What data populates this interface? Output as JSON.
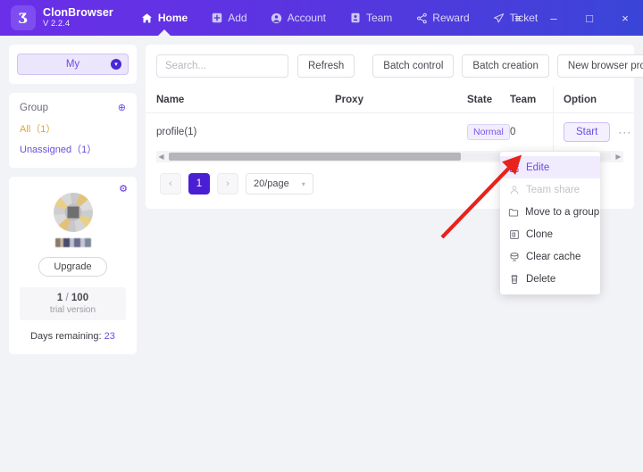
{
  "app": {
    "brand_name": "ClonBrowser",
    "version": "V 2.2.4",
    "logo_glyph": "Ʒ"
  },
  "nav": {
    "items": [
      {
        "label": "Home",
        "icon": "home-icon",
        "active": true
      },
      {
        "label": "Add",
        "icon": "add-icon",
        "active": false
      },
      {
        "label": "Account",
        "icon": "account-icon",
        "active": false
      },
      {
        "label": "Team",
        "icon": "team-icon",
        "active": false
      },
      {
        "label": "Reward",
        "icon": "reward-icon",
        "active": false
      },
      {
        "label": "Ticket",
        "icon": "ticket-icon",
        "active": false
      }
    ],
    "window_controls": [
      {
        "name": "menu-icon",
        "glyph": "≡"
      },
      {
        "name": "minimize-icon",
        "glyph": "–"
      },
      {
        "name": "maximize-icon",
        "glyph": "□"
      },
      {
        "name": "close-icon",
        "glyph": "×"
      }
    ]
  },
  "sidebar": {
    "profile_select": {
      "value": "My",
      "caret": "▾"
    },
    "group": {
      "title": "Group",
      "add_icon": "⊕",
      "items": [
        {
          "label": "All（1）",
          "selected": true
        },
        {
          "label": "Unassigned（1）",
          "selected": false
        }
      ]
    },
    "account": {
      "gear_icon": "⚙",
      "upgrade_label": "Upgrade",
      "quota_used": "1",
      "quota_sep": " / ",
      "quota_total": "100",
      "quota_sub": "trial version",
      "days_label": "Days remaining:",
      "days_value": "23"
    }
  },
  "toolbar": {
    "search_placeholder": "Search...",
    "search_value": "",
    "refresh_label": "Refresh",
    "batch_control_label": "Batch control",
    "batch_creation_label": "Batch creation",
    "new_profile_label": "New browser profile"
  },
  "table": {
    "columns": [
      "Name",
      "Proxy",
      "State",
      "Team",
      "Option"
    ],
    "rows": [
      {
        "name": "profile(1)",
        "proxy": "",
        "state": "Normal",
        "team": "0",
        "start_label": "Start",
        "more_glyph": "···"
      }
    ],
    "scroll_left_glyph": "◀",
    "scroll_right_glyph": "▶"
  },
  "pagination": {
    "prev_glyph": "‹",
    "next_glyph": "›",
    "current_page": "1",
    "page_size": "20/page",
    "caret": "▾"
  },
  "context_menu": {
    "items": [
      {
        "label": "Edite",
        "icon": "edit-icon",
        "state": "highlighted"
      },
      {
        "label": "Team share",
        "icon": "person-icon",
        "state": "disabled"
      },
      {
        "label": "Move to a group",
        "icon": "folder-icon",
        "state": "normal"
      },
      {
        "label": "Clone",
        "icon": "copy-icon",
        "state": "normal"
      },
      {
        "label": "Clear cache",
        "icon": "clear-cache-icon",
        "state": "normal"
      },
      {
        "label": "Delete",
        "icon": "trash-icon",
        "state": "normal"
      }
    ]
  },
  "annotation": {
    "arrow_color": "#e8221c",
    "from": "495,266",
    "to": "578,180"
  },
  "colors": {
    "header_from": "#6b2fe8",
    "header_to": "#3a45d8",
    "accent": "#6b4ce0",
    "page_bg": "#f2f3f7",
    "selected_group": "#e2a33a",
    "pager_active": "#4a1fd4"
  }
}
